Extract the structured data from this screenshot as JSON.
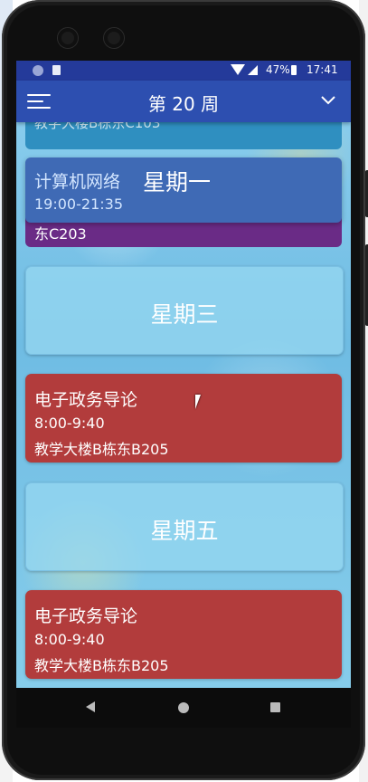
{
  "status_bar": {
    "battery": "47%",
    "time": "17:41"
  },
  "app_bar": {
    "title": "第 20 周"
  },
  "partial_top_text": "教学大楼B栋东C103",
  "overlay_card": {
    "course": "计算机网络",
    "day": "星期一",
    "time": "19:00-21:35"
  },
  "purple_card_text": "东C203",
  "cards": [
    {
      "type": "day",
      "label": "星期三"
    },
    {
      "type": "course",
      "name": "电子政务导论",
      "time": "8:00-9:40",
      "location": "教学大楼B栋东B205",
      "color": "#b23c3c"
    },
    {
      "type": "day",
      "label": "星期五"
    },
    {
      "type": "course",
      "name": "电子政务导论",
      "time": "8:00-9:40",
      "location": "教学大楼B栋东B205",
      "color": "#b23c3c"
    }
  ],
  "colors": {
    "status_bar": "#243a9a",
    "app_bar": "#2d4fb0",
    "course_red": "#b23c3c",
    "course_purple": "#6a2b86",
    "overlay_blue": "#3f6ab5"
  },
  "icons": {
    "menu": "hamburger-icon",
    "dropdown": "chevron-down-icon",
    "nav_back": "back-triangle-icon",
    "nav_home": "home-circle-icon",
    "nav_recent": "recents-square-icon"
  }
}
